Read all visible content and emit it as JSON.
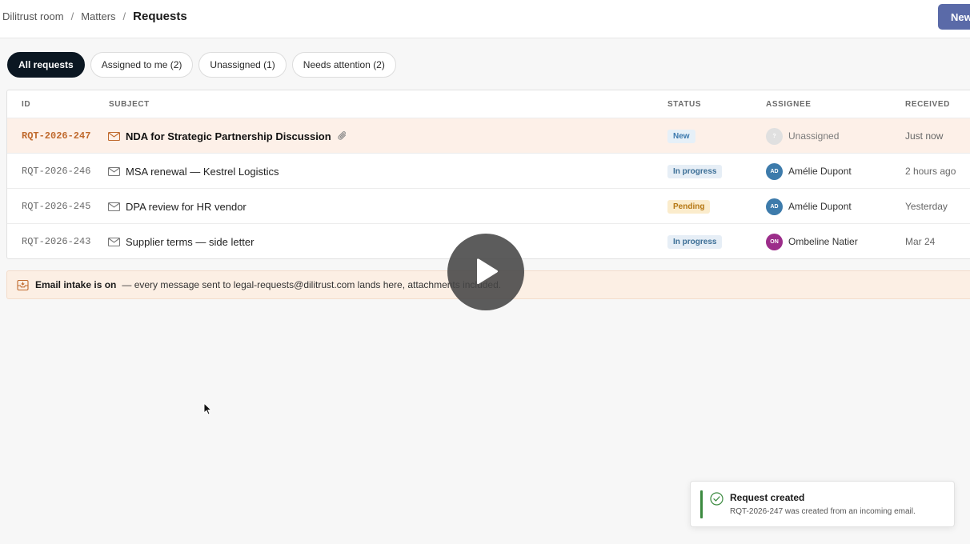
{
  "breadcrumb": {
    "items": [
      "Dilitrust room",
      "Matters"
    ],
    "separator": "/",
    "current": "Requests"
  },
  "header": {
    "new_button_label": "New"
  },
  "tabs": [
    {
      "label": "All requests",
      "active": true
    },
    {
      "label": "Assigned to me (2)",
      "active": false
    },
    {
      "label": "Unassigned (1)",
      "active": false
    },
    {
      "label": "Needs attention (2)",
      "active": false
    }
  ],
  "table": {
    "columns": {
      "id": "ID",
      "subject": "SUBJECT",
      "status": "STATUS",
      "assignee": "ASSIGNEE",
      "received": "RECEIVED"
    },
    "rows": [
      {
        "id": "RQT-2026-247",
        "subject": "NDA for Strategic Partnership Discussion",
        "status": "New",
        "status_icon": "new",
        "assignee": "Unassigned",
        "assignee_initials": "?",
        "received": "Just now",
        "has_attachment": true,
        "highlight": true
      },
      {
        "id": "RQT-2026-246",
        "subject": "MSA renewal — Kestrel Logistics",
        "status": "In progress",
        "status_icon": "progress",
        "assignee": "Amélie Dupont",
        "assignee_initials": "AD",
        "received": "2 hours ago"
      },
      {
        "id": "RQT-2026-245",
        "subject": "DPA review for HR vendor",
        "status": "Pending",
        "status_icon": "pending",
        "assignee": "Amélie Dupont",
        "assignee_initials": "AD",
        "received": "Yesterday"
      },
      {
        "id": "RQT-2026-243",
        "subject": "Supplier terms — side letter",
        "status": "In progress",
        "status_icon": "progress",
        "assignee": "Ombeline Natier",
        "assignee_initials": "ON",
        "received": "Mar 24"
      }
    ]
  },
  "banner": {
    "title": "Email intake is on",
    "text": "— every message sent to legal-requests@dilitrust.com lands here, attachments included."
  },
  "toast": {
    "title": "Request created",
    "message": "RQT-2026-247 was created from an incoming email."
  },
  "colors": {
    "primary_button": "#5a6aa8",
    "active_tab": "#0b1722",
    "highlight_row": "#fdf0e8",
    "highlight_id": "#c06a2e",
    "success": "#3b8a3f",
    "avatar_ad": "#3d7bab",
    "avatar_on": "#9c2d8a"
  }
}
